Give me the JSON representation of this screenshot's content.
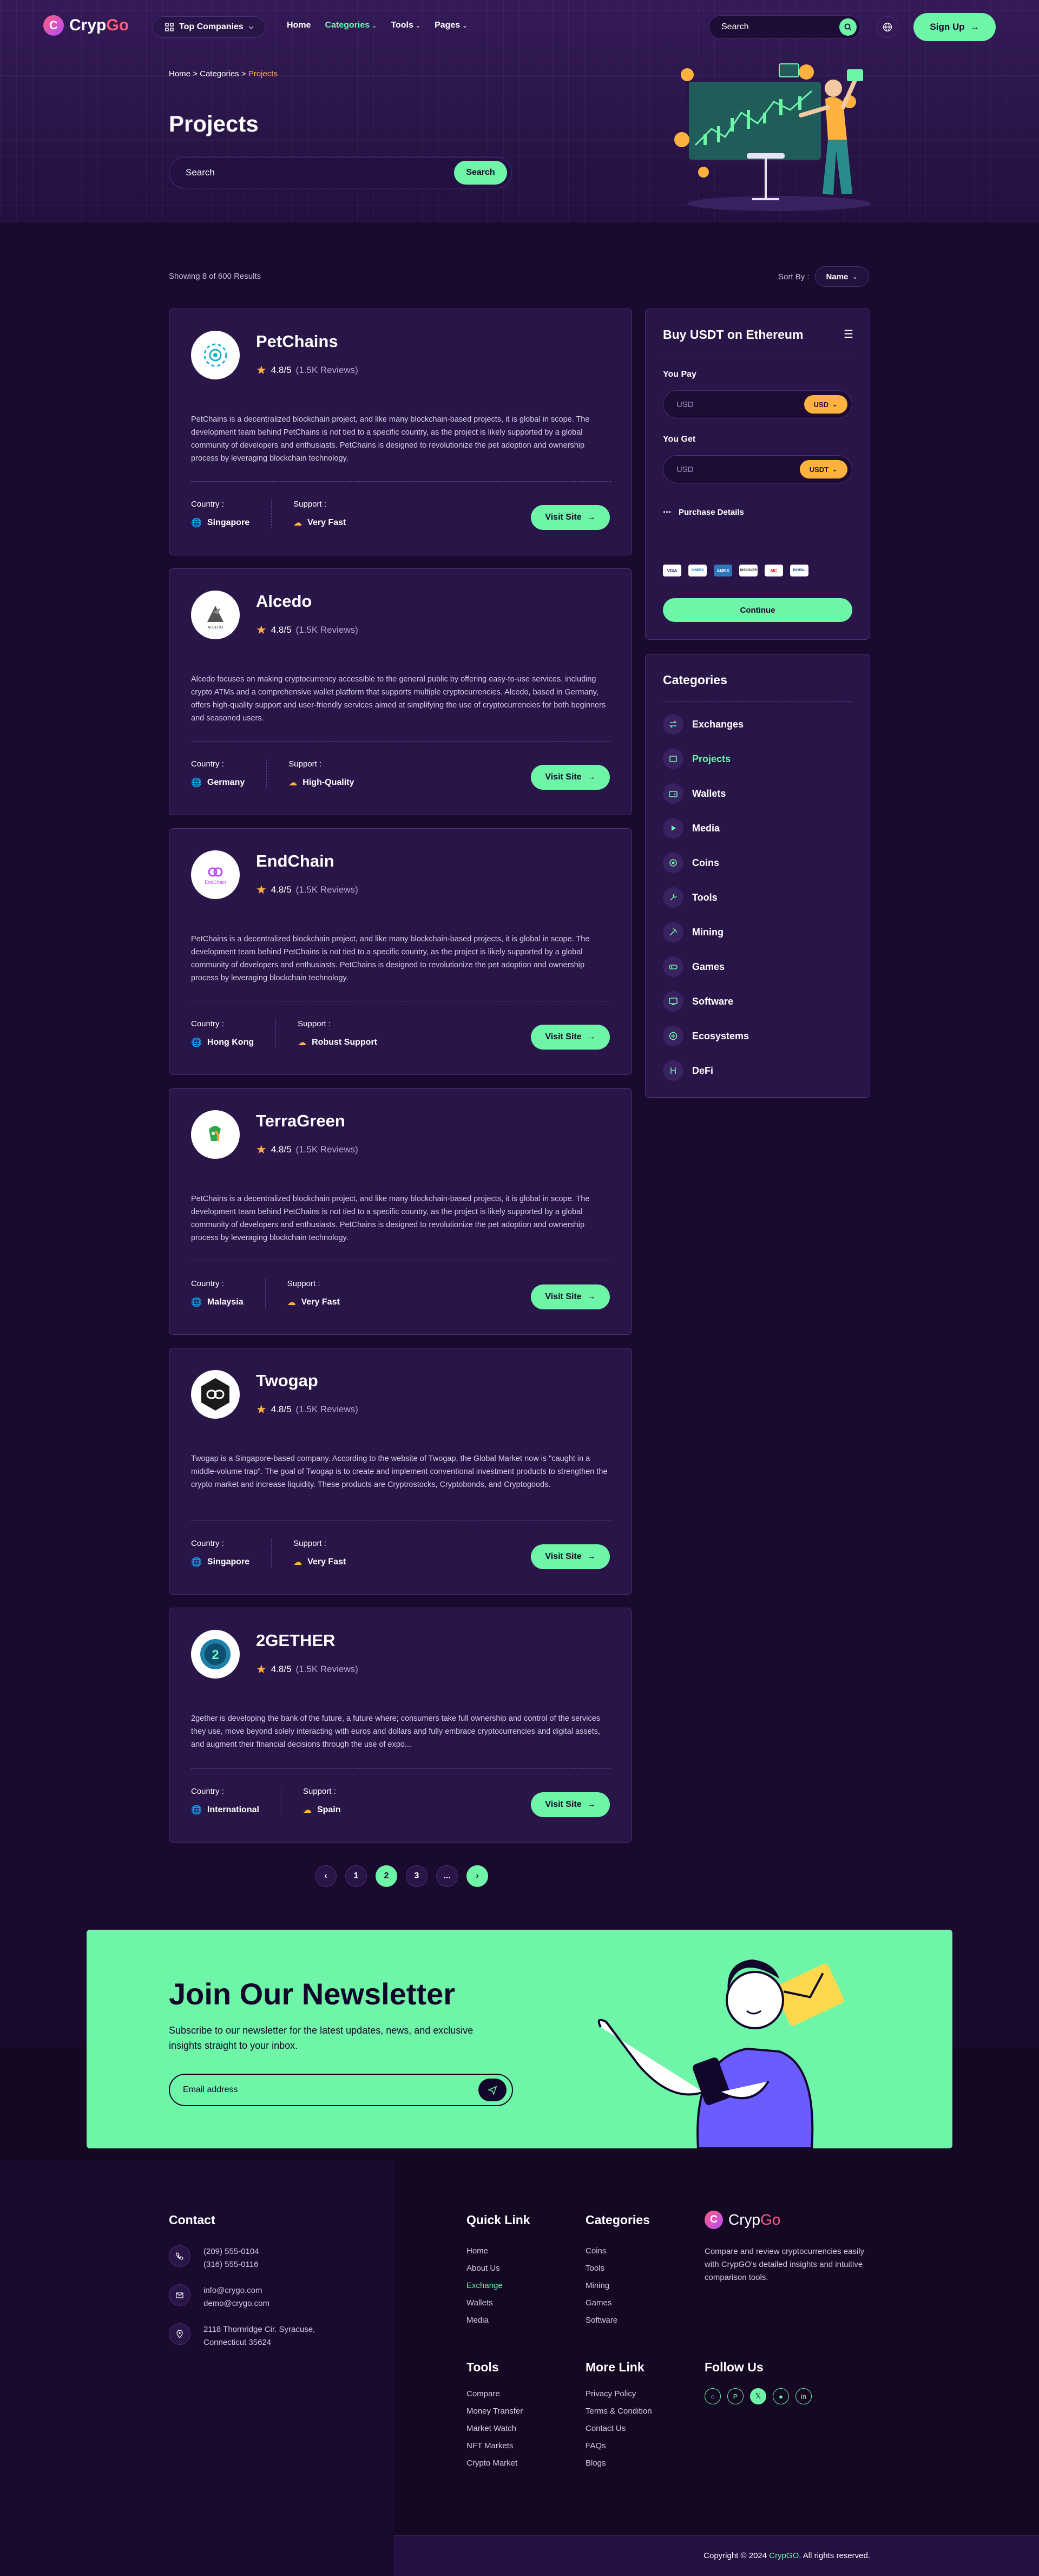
{
  "header": {
    "logo_prefix": "Cryp",
    "logo_suffix": "Go",
    "top_companies": "Top Companies",
    "menu": [
      "Home",
      "Categories",
      "Tools",
      "Pages"
    ],
    "search_placeholder": "Search",
    "signup": "Sign Up"
  },
  "hero": {
    "breadcrumb": [
      "Home",
      "Categories",
      "Projects"
    ],
    "title": "Projects",
    "search_placeholder": "Search",
    "search_button": "Search"
  },
  "listing": {
    "showing": "Showing 8 of 600 Results",
    "sort_label": "Sort By :",
    "sort_value": "Name"
  },
  "cards": [
    {
      "name": "PetChains",
      "rating": "4.8/5",
      "reviews": "(1.5K Reviews)",
      "desc": "PetChains is a decentralized blockchain project, and like many blockchain-based projects, it is global in scope. The development team behind PetChains is not tied to a specific country, as the project is likely supported by a global community of developers and enthusiasts. PetChains is designed to revolutionize the pet adoption and ownership process by leveraging blockchain technology.",
      "country_label": "Country :",
      "country": "Singapore",
      "support_label": "Support :",
      "support": "Very Fast",
      "visit": "Visit Site"
    },
    {
      "name": "Alcedo",
      "rating": "4.8/5",
      "reviews": "(1.5K Reviews)",
      "desc": "Alcedo focuses on making cryptocurrency accessible to the general public by offering easy-to-use services, including crypto ATMs and a comprehensive wallet platform that supports multiple cryptocurrencies. Alcedo, based in Germany, offers high-quality support and user-friendly services aimed at simplifying the use of cryptocurrencies for both beginners and seasoned users.",
      "country_label": "Country :",
      "country": "Germany",
      "support_label": "Support :",
      "support": "High-Quality",
      "visit": "Visit Site",
      "logo_text": "ALCEDO"
    },
    {
      "name": "EndChain",
      "rating": "4.8/5",
      "reviews": "(1.5K Reviews)",
      "desc": "PetChains is a decentralized blockchain project, and like many blockchain-based projects, it is global in scope. The development team behind PetChains is not tied to a specific country, as the project is likely supported by a global community of developers and enthusiasts. PetChains is designed to revolutionize the pet adoption and ownership process by leveraging blockchain technology.",
      "country_label": "Country :",
      "country": "Hong Kong",
      "support_label": "Support :",
      "support": "Robust Support",
      "visit": "Visit Site",
      "logo_text": "EndChain"
    },
    {
      "name": "TerraGreen",
      "rating": "4.8/5",
      "reviews": "(1.5K Reviews)",
      "desc": "PetChains is a decentralized blockchain project, and like many blockchain-based projects, it is global in scope. The development team behind PetChains is not tied to a specific country, as the project is likely supported by a global community of developers and enthusiasts. PetChains is designed to revolutionize the pet adoption and ownership process by leveraging blockchain technology.",
      "country_label": "Country :",
      "country": "Malaysia",
      "support_label": "Support :",
      "support": "Very Fast",
      "visit": "Visit Site"
    },
    {
      "name": "Twogap",
      "rating": "4.8/5",
      "reviews": "(1.5K Reviews)",
      "desc": "Twogap is a Singapore-based company. According to the website of Twogap, the Global Market now is \"caught in a middle-volume trap\". The goal of Twogap is to create and implement conventional investment products to strengthen the crypto market and increase liquidity. These products are Cryptrostocks, Cryptobonds, and Cryptogoods.",
      "country_label": "Country :",
      "country": "Singapore",
      "support_label": "Support :",
      "support": "Very Fast",
      "visit": "Visit Site"
    },
    {
      "name": "2GETHER",
      "rating": "4.8/5",
      "reviews": "(1.5K Reviews)",
      "desc": "2gether is developing the bank of the future, a future where; consumers take full ownership and control of the services they use, move beyond solely interacting with euros and dollars and fully embrace cryptocurrencies and digital assets, and augment their financial decisions through the use of expo...",
      "country_label": "Country :",
      "country": "International",
      "support_label": "Support :",
      "support": "Spain",
      "visit": "Visit Site"
    }
  ],
  "buy_widget": {
    "title": "Buy USDT on Ethereum",
    "you_pay": "You Pay",
    "pay_placeholder": "USD",
    "pay_currency": "USD",
    "you_get": "You Get",
    "get_placeholder": "USD",
    "get_currency": "USDT",
    "purchase_details": "Purchase Details",
    "pay_methods": [
      "VISA",
      "DINERS",
      "AMEX",
      "DISCOVER",
      "MC",
      "PAYPAL"
    ],
    "continue": "Continue"
  },
  "categories": {
    "title": "Categories",
    "items": [
      "Exchanges",
      "Projects",
      "Wallets",
      "Media",
      "Coins",
      "Tools",
      "Mining",
      "Games",
      "Software",
      "Ecosystems",
      "DeFi"
    ],
    "active": "Projects"
  },
  "pagination": {
    "pages": [
      "1",
      "2",
      "3",
      "..."
    ],
    "current": "2"
  },
  "newsletter": {
    "title": "Join Our Newsletter",
    "text": "Subscribe to our newsletter for the latest updates, news, and exclusive insights straight to your inbox.",
    "placeholder": "Email address"
  },
  "footer": {
    "contact_title": "Contact",
    "phones": [
      "(209) 555-0104",
      "(316) 555-0116"
    ],
    "emails": [
      "info@crygo.com",
      "demo@crygo.com"
    ],
    "address": [
      "2118 Thornridge Cir. Syracuse,",
      "Connecticut 35624"
    ],
    "quick_title": "Quick Link",
    "quick": [
      "Home",
      "About Us",
      "Exchange",
      "Wallets",
      "Media"
    ],
    "cat_title": "Categories",
    "cats": [
      "Coins",
      "Tools",
      "Mining",
      "Games",
      "Software"
    ],
    "brand_prefix": "Cryp",
    "brand_suffix": "Go",
    "brand_text": "Compare and review cryptocurrencies easily with CrypGO's detailed insights and intuitive comparison tools.",
    "tools_title": "Tools",
    "tools": [
      "Compare",
      "Money Transfer",
      "Market Watch",
      "NFT Markets",
      "Crypto Market"
    ],
    "more_title": "More Link",
    "more": [
      "Privacy Policy",
      "Terms & Condition",
      "Contact Us",
      "FAQs",
      "Blogs"
    ],
    "follow_title": "Follow Us",
    "copyright_prefix": "Copyright © 2024 ",
    "copyright_brand": "CrypGO",
    "copyright_suffix": ". All rights reserved."
  },
  "colors": {
    "accent": "#6ef5a8",
    "brand": "#ff5d7d",
    "bg": "#1a0a2e",
    "card": "#2a1548",
    "gold": "#ffb23e"
  }
}
